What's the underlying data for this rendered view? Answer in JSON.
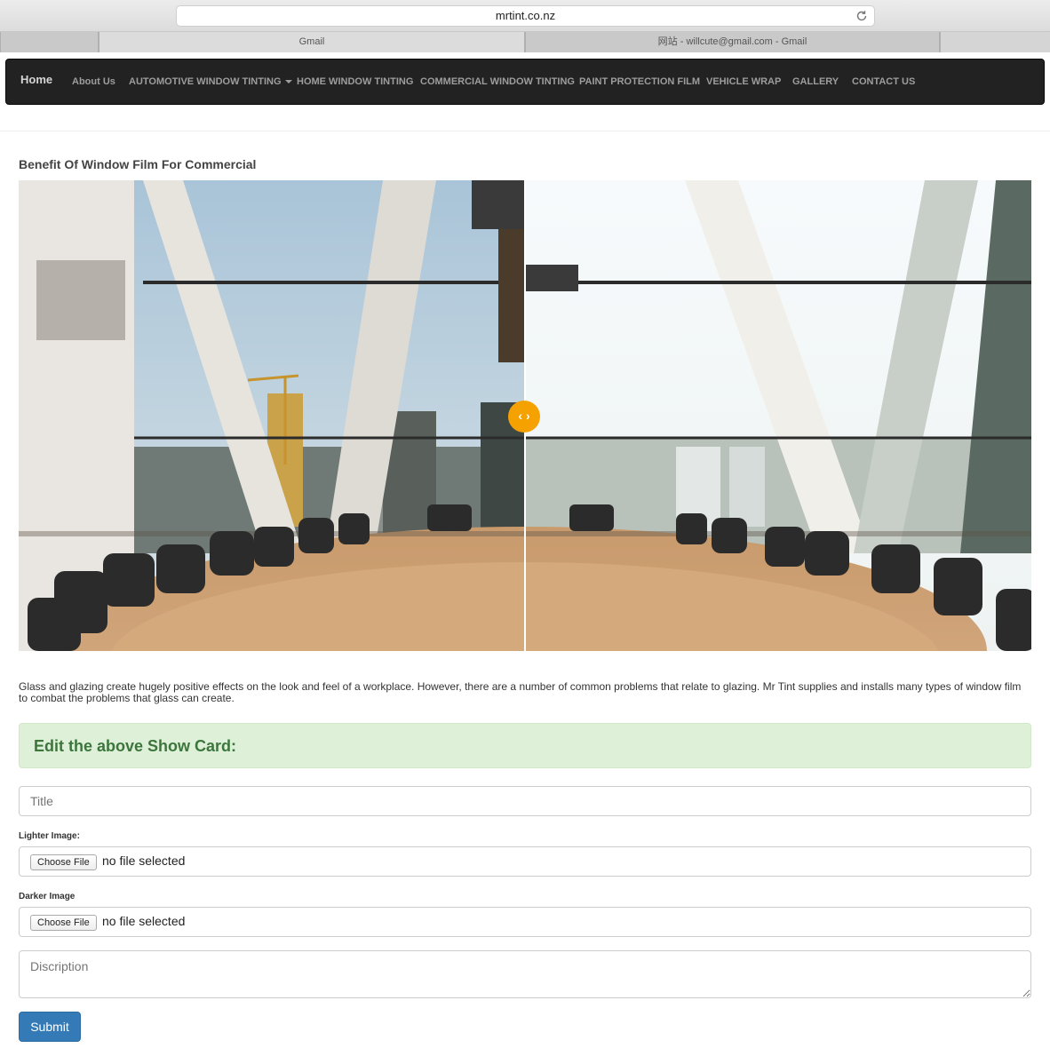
{
  "browser": {
    "url": "mrtint.co.nz",
    "tabs": [
      {
        "label": ""
      },
      {
        "label": "Gmail"
      },
      {
        "label": "网站 - willcute@gmail.com - Gmail"
      },
      {
        "label": ""
      }
    ]
  },
  "nav": {
    "items": [
      "Home",
      "About Us",
      "AUTOMOTIVE WINDOW TINTING",
      "HOME WINDOW TINTING",
      "COMMERCIAL WINDOW TINTING",
      "PAINT PROTECTION FILM",
      "VEHICLE WRAP",
      "GALLERY",
      "CONTACT US"
    ]
  },
  "card": {
    "title": "Benefit Of Window Film For Commercial",
    "compare_handle": "‹ ›",
    "split_fraction": 0.5,
    "description": "Glass and glazing create hugely positive effects on the look and feel of a workplace. However, there are a number of common problems that relate to glazing. Mr Tint supplies and installs many types of window film to combat the problems that glass can create."
  },
  "form": {
    "heading": "Edit the above Show Card:",
    "title_placeholder": "Title",
    "lighter_label": "Lighter Image:",
    "darker_label": "Darker Image",
    "choose_file": "Choose File",
    "no_file": "no file selected",
    "description_placeholder": "Discription",
    "submit": "Submit"
  },
  "colors": {
    "navbar": "#222222",
    "alert_bg": "#dff0d8",
    "alert_text": "#3c763d",
    "handle": "#f5a100",
    "primary": "#337ab7"
  }
}
